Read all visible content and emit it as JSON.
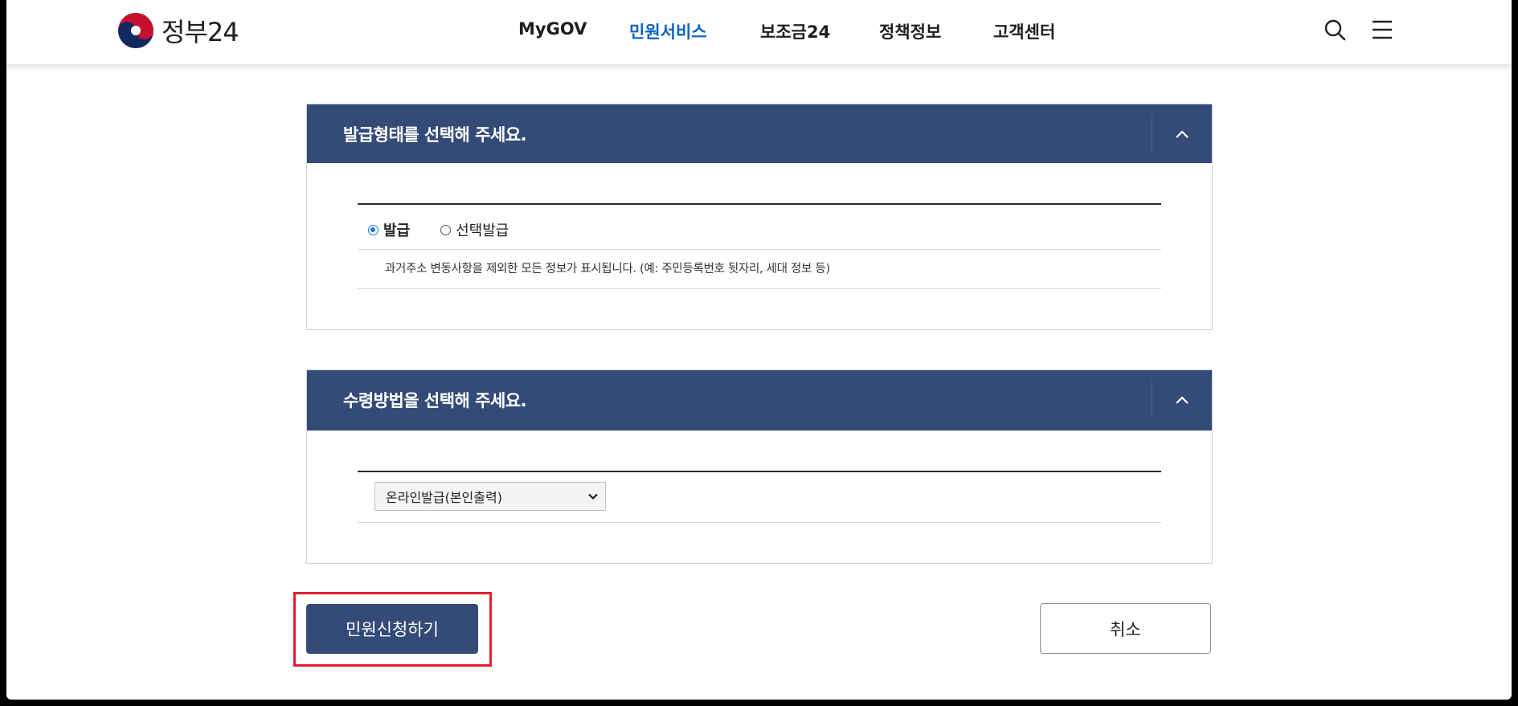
{
  "header": {
    "logo_text": "정부24",
    "nav": [
      "MyGOV",
      "민원서비스",
      "보조금24",
      "정책정보",
      "고객센터"
    ],
    "active_nav": "민원서비스",
    "active_color": "#0b63c6"
  },
  "issue_section": {
    "title": "발급형태를 선택해 주세요.",
    "options": [
      {
        "label": "발급",
        "checked": true
      },
      {
        "label": "선택발급",
        "checked": false
      }
    ],
    "description": "과거주소 변동사항을 제외한 모든 정보가 표시됩니다. (예: 주민등록번호 뒷자리, 세대 정보 등)"
  },
  "receive_section": {
    "title": "수령방법을 선택해 주세요.",
    "selected": "온라인발급(본인출력)"
  },
  "actions": {
    "submit_label": "민원신청하기",
    "cancel_label": "취소"
  },
  "colors": {
    "panel_header": "#344b78",
    "highlight": "#e0202b"
  }
}
